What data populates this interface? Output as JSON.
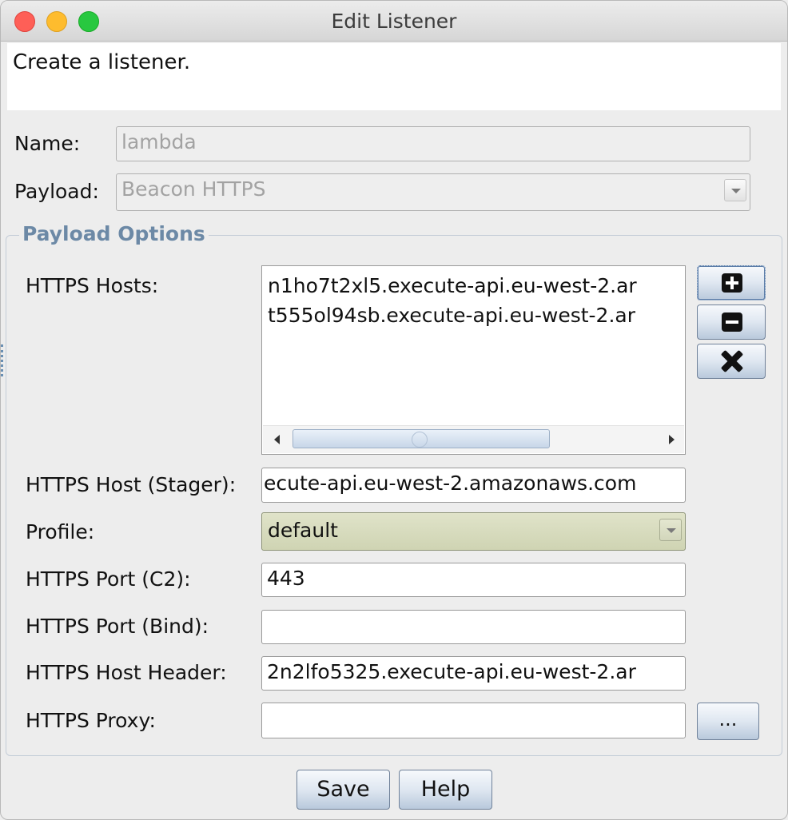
{
  "window": {
    "title": "Edit Listener"
  },
  "description": "Create a listener.",
  "form": {
    "name_label": "Name:",
    "name_value": "lambda",
    "payload_label": "Payload:",
    "payload_value": "Beacon HTTPS"
  },
  "options": {
    "group_title": "Payload Options",
    "hosts_label": "HTTPS Hosts:",
    "hosts": [
      "n1ho7t2xl5.execute-api.eu-west-2.ar",
      "t555ol94sb.execute-api.eu-west-2.ar"
    ],
    "stager_label": "HTTPS Host (Stager):",
    "stager_value": "ecute-api.eu-west-2.amazonaws.com",
    "profile_label": "Profile:",
    "profile_value": "default",
    "port_c2_label": "HTTPS Port (C2):",
    "port_c2_value": "443",
    "port_bind_label": "HTTPS Port (Bind):",
    "port_bind_value": "",
    "host_header_label": "HTTPS Host Header:",
    "host_header_value": "2n2lfo5325.execute-api.eu-west-2.ar",
    "proxy_label": "HTTPS Proxy:",
    "proxy_value": "",
    "proxy_button": "..."
  },
  "icons": {
    "add": "plus-icon",
    "remove": "minus-icon",
    "clear": "x-icon"
  },
  "buttons": {
    "save": "Save",
    "help": "Help"
  }
}
